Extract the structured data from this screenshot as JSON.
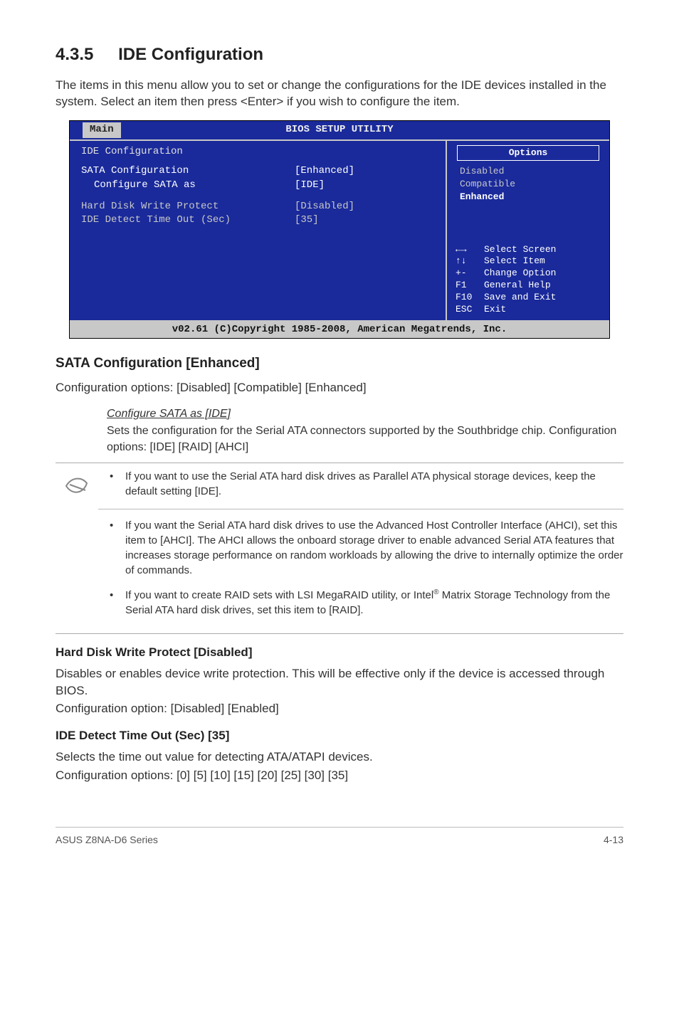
{
  "section": {
    "number": "4.3.5",
    "title": "IDE Configuration"
  },
  "intro": "The items in this menu allow you to set or change the configurations for the IDE devices installed in the system. Select an item then press <Enter> if you wish to configure the item.",
  "bios": {
    "title": "BIOS SETUP UTILITY",
    "tab": "Main",
    "left_title": "IDE Configuration",
    "rows": [
      {
        "label": "SATA Configuration",
        "value": "[Enhanced]",
        "sel": true
      },
      {
        "label": "Configure SATA as",
        "value": "[IDE]",
        "indent": true,
        "sel": true
      },
      {
        "label": "Hard Disk Write Protect",
        "value": "[Disabled]"
      },
      {
        "label": "IDE Detect Time Out (Sec)",
        "value": "[35]"
      }
    ],
    "options_header": "Options",
    "options": [
      {
        "text": "Disabled"
      },
      {
        "text": "Compatible"
      },
      {
        "text": "Enhanced",
        "selected": true
      }
    ],
    "help": [
      {
        "key": "←→",
        "desc": "Select Screen"
      },
      {
        "key": "↑↓",
        "desc": "Select Item"
      },
      {
        "key": "+-",
        "desc": "Change Option"
      },
      {
        "key": "F1",
        "desc": "General Help"
      },
      {
        "key": "F10",
        "desc": "Save and Exit"
      },
      {
        "key": "ESC",
        "desc": "Exit"
      }
    ],
    "footer": "v02.61 (C)Copyright 1985-2008, American Megatrends, Inc."
  },
  "sata": {
    "heading": "SATA Configuration [Enhanced]",
    "line": "Configuration options: [Disabled] [Compatible] [Enhanced]",
    "sub_title": "Configure SATA as [IDE]",
    "sub_body": "Sets the configuration for the Serial ATA connectors supported by the Southbridge chip. Configuration options: [IDE] [RAID] [AHCI]"
  },
  "notes": {
    "b1": "If you want to use the Serial ATA hard disk drives as Parallel ATA physical storage devices, keep the default setting [IDE].",
    "b2": "If you want the Serial ATA hard disk drives to use the Advanced Host Controller Interface (AHCI), set this item to [AHCI]. The AHCI allows the onboard storage driver to enable advanced Serial ATA features that increases storage performance on random workloads by allowing the drive to internally optimize the order of commands.",
    "b3a": "If you want to create RAID sets with LSI MegaRAID utility, or Intel",
    "b3b": " Matrix Storage Technology from the Serial ATA hard disk drives, set this item to [RAID]."
  },
  "hdwp": {
    "heading": "Hard Disk Write Protect [Disabled]",
    "l1": "Disables or enables device write protection. This will be effective only if the device is accessed through BIOS.",
    "l2": "Configuration option: [Disabled] [Enabled]"
  },
  "ide_to": {
    "heading": "IDE Detect Time Out (Sec) [35]",
    "l1": "Selects the time out value for detecting ATA/ATAPI devices.",
    "l2": "Configuration options: [0] [5] [10] [15] [20] [25] [30] [35]"
  },
  "footer": {
    "left": "ASUS Z8NA-D6 Series",
    "right": "4-13"
  }
}
